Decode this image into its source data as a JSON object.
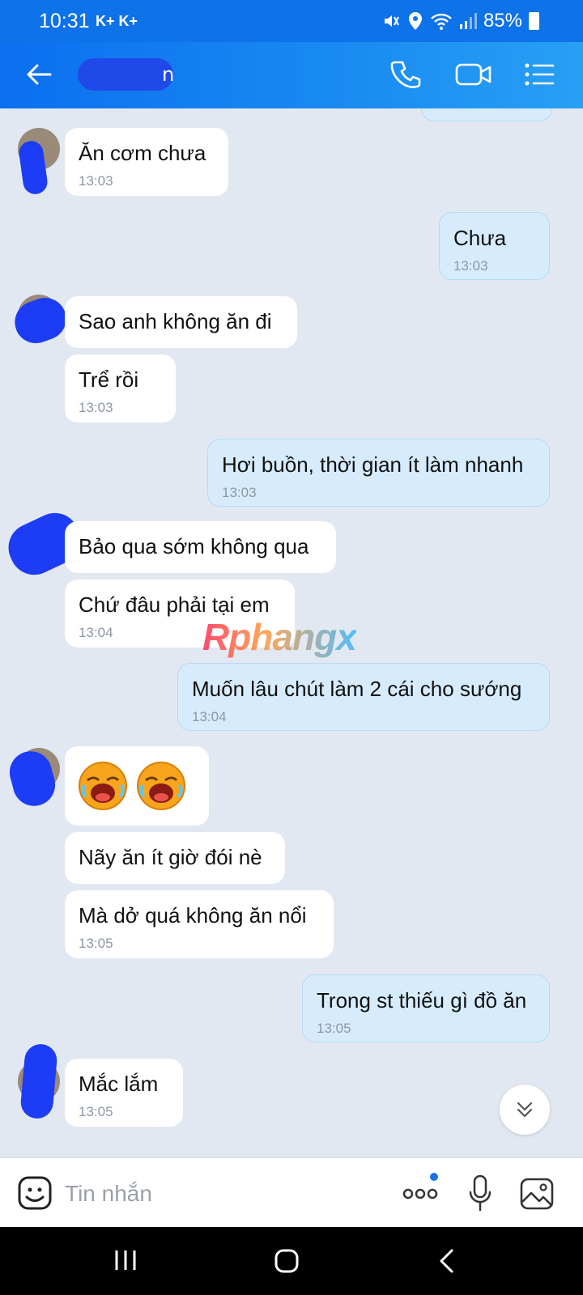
{
  "status_bar": {
    "time": "10:31",
    "carrier": "K+ K+",
    "battery": "85%",
    "icons": [
      "mute-icon",
      "location-icon",
      "wifi-icon",
      "signal-icon",
      "battery-icon"
    ]
  },
  "header": {
    "contact_name_visible": "n",
    "icons": [
      "back-arrow-icon",
      "phone-icon",
      "video-call-icon",
      "menu-list-icon"
    ]
  },
  "messages": [
    {
      "id": "m1",
      "dir": "in",
      "text": "Ăn cơm chưa",
      "time": "13:03"
    },
    {
      "id": "m2",
      "dir": "out",
      "text": "Chưa",
      "time": "13:03"
    },
    {
      "id": "m3",
      "dir": "in",
      "text": "Sao anh không ăn đi",
      "time": ""
    },
    {
      "id": "m4",
      "dir": "in",
      "text": "Trể rồi",
      "time": "13:03"
    },
    {
      "id": "m5",
      "dir": "out",
      "text": "Hơi buồn, thời gian ít làm nhanh",
      "time": "13:03"
    },
    {
      "id": "m6",
      "dir": "in",
      "text": "Bảo qua sớm không qua",
      "time": ""
    },
    {
      "id": "m7",
      "dir": "in",
      "text": "Chứ đâu phải tại em",
      "time": "13:04"
    },
    {
      "id": "m8",
      "dir": "out",
      "text": "Muốn lâu chút làm 2 cái cho sướng",
      "time": "13:04"
    },
    {
      "id": "m9",
      "dir": "in",
      "text": "",
      "time": "",
      "emoji": "laughing-crying-emoji x2"
    },
    {
      "id": "m10",
      "dir": "in",
      "text": "Nãy ăn ít giờ đói nè",
      "time": ""
    },
    {
      "id": "m11",
      "dir": "in",
      "text": "Mà dở quá không ăn nổi",
      "time": "13:05"
    },
    {
      "id": "m12",
      "dir": "out",
      "text": "Trong st thiếu gì đồ ăn",
      "time": "13:05"
    },
    {
      "id": "m13",
      "dir": "in",
      "text": "Mắc lắm",
      "time": "13:05"
    }
  ],
  "watermark": "Rphangx",
  "composer": {
    "placeholder": "Tin nhắn",
    "icons": [
      "sticker-icon",
      "more-dots-icon",
      "microphone-icon",
      "image-icon"
    ]
  },
  "nav_bar": {
    "icons": [
      "recent-apps-icon",
      "home-icon",
      "back-icon"
    ]
  },
  "colors": {
    "header": "#0e72e8",
    "outgoing_bubble": "#d6ecfd",
    "incoming_bubble": "#ffffff",
    "background": "#e2e8f1"
  }
}
